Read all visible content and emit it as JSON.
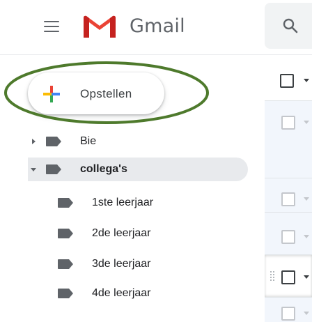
{
  "header": {
    "brand": "Gmail",
    "icons": {
      "menu": "hamburger-menu-icon",
      "logo": "gmail-logo",
      "search": "search-icon"
    }
  },
  "compose": {
    "label": "Opstellen",
    "icon": "plus-icon"
  },
  "sidebar": {
    "items": [
      {
        "label": "Bie",
        "expand": "collapsed",
        "bold": false
      },
      {
        "label": "collega's",
        "expand": "expanded",
        "bold": true,
        "active": true
      },
      {
        "label": "1ste leerjaar",
        "bold": false
      },
      {
        "label": "2de leerjaar",
        "bold": false
      },
      {
        "label": "3de leerjaar",
        "bold": false
      },
      {
        "label": "4de leerjaar",
        "bold": false
      }
    ]
  },
  "colors": {
    "gmail_red": "#ea4335",
    "gmail_dark_red": "#c5221f",
    "highlight_green": "#4e7a2c",
    "label_gray": "#5f6368",
    "active_bg": "#e8eaed",
    "read_row_bg": "#f2f6fc"
  }
}
